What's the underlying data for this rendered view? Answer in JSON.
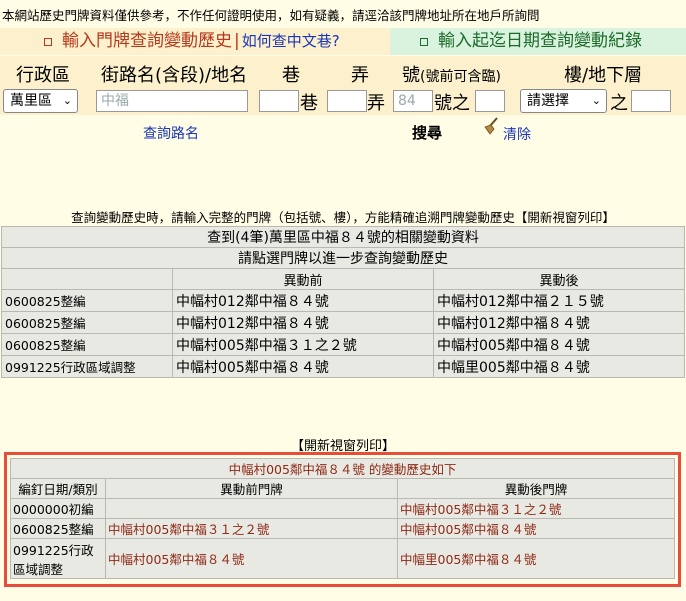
{
  "notice": "本網站歷史門牌資料僅供參考，不作任何證明使用，如有疑義，請逕洽該門牌地址所在地戶所詢問",
  "tabs": {
    "address_query": "輸入門牌查詢變動歷史",
    "lane_help_link": "如何查中文巷?",
    "date_query": "輸入起迄日期查詢變動紀錄"
  },
  "form": {
    "headers": {
      "district": "行政區",
      "street": "街路名(含段)/地名",
      "lane": "巷",
      "alley": "弄",
      "number": "號",
      "number_note": "(號前可含臨)",
      "floor": "樓/地下層"
    },
    "district_value": "萬里區",
    "street_placeholder": "中福",
    "lane_suffix": "巷",
    "alley_suffix": "弄",
    "number_placeholder": "84",
    "number_suffix": "號之",
    "floor_value": "請選擇",
    "floor_suffix": "之",
    "query_street_link": "查詢路名",
    "search_button": "搜尋",
    "clear_link": "清除"
  },
  "hint": "查詢變動歷史時，請輸入完整的門牌（包括號、樓），方能精確追溯門牌變動歷史",
  "print_link": "【開新視窗列印】",
  "results": {
    "title": "查到(4筆)萬里區中福８４號的相關變動資料",
    "subtitle": "請點選門牌以進一步查詢變動歷史",
    "col_before": "異動前",
    "col_after": "異動後",
    "rows": [
      {
        "type": "0600825整編",
        "before": "中幅村012鄰中福８４號",
        "after": "中幅村012鄰中福２１５號"
      },
      {
        "type": "0600825整編",
        "before": "中幅村012鄰中福８４號",
        "after": "中幅村012鄰中福８４號"
      },
      {
        "type": "0600825整編",
        "before": "中幅村005鄰中福３１之２號",
        "after": "中幅村005鄰中福８４號"
      },
      {
        "type": "0991225行政區域調整",
        "before": "中幅村005鄰中福８４號",
        "after": "中幅里005鄰中福８４號"
      }
    ]
  },
  "history": {
    "print_link": "【開新視窗列印】",
    "title": "中幅村005鄰中福８４號 的變動歷史如下",
    "col_date": "編釘日期/類別",
    "col_before": "異動前門牌",
    "col_after": "異動後門牌",
    "rows": [
      {
        "date": "0000000初編",
        "before": "",
        "after": "中幅村005鄰中福３１之２號"
      },
      {
        "date": "0600825整編",
        "before": "中幅村005鄰中福３１之２號",
        "after": "中幅村005鄰中福８４號"
      },
      {
        "date": "0991225行政區域調整",
        "before": "中幅村005鄰中福８４號",
        "after": "中幅里005鄰中福８４號"
      }
    ]
  },
  "colors": {
    "page_bg": "#fffde6",
    "accent_red": "#e64d3a",
    "link_blue": "#1a35b7",
    "tab_green_bg": "#d9f3de"
  }
}
